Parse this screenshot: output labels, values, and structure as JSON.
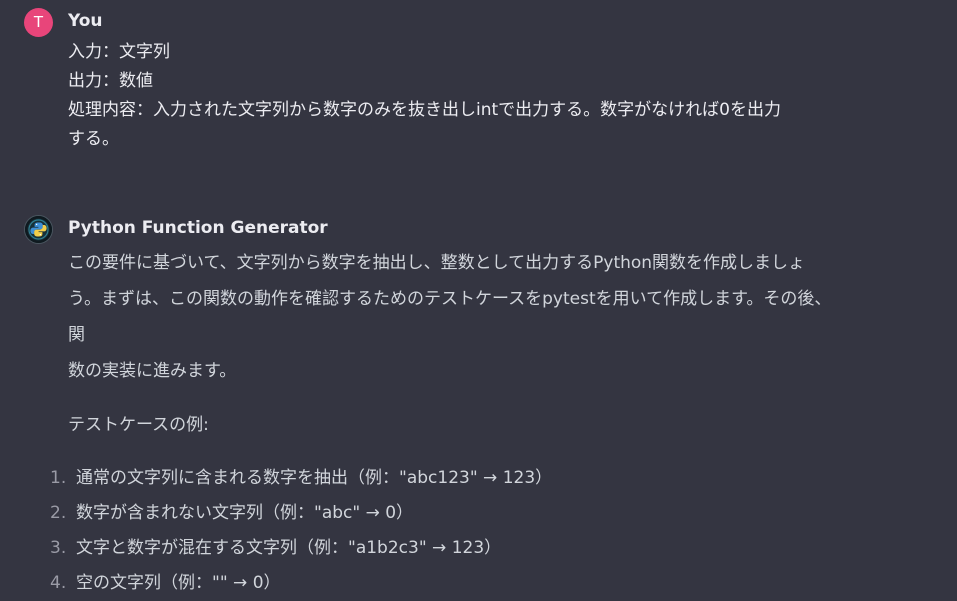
{
  "colors": {
    "background": "#343541",
    "text": "#ececf1",
    "user_avatar": "#e8457a"
  },
  "user_message": {
    "avatar_letter": "T",
    "author": "You",
    "lines": [
      "入力：文字列",
      "出力：数値",
      "処理内容：入力された文字列から数字のみを抜き出しintで出力する。数字がなければ0を出力",
      "する。"
    ]
  },
  "assistant_message": {
    "avatar_icon": "python-icon",
    "author": "Python Function Generator",
    "intro_lines": [
      "この要件に基づいて、文字列から数字を抽出し、整数として出力するPython関数を作成しましょ",
      "う。まずは、この関数の動作を確認するためのテストケースをpytestを用いて作成します。その後、関",
      "数の実装に進みます。"
    ],
    "test_heading": "テストケースの例:",
    "test_cases": [
      {
        "number": "1.",
        "text": "通常の文字列に含まれる数字を抽出（例：\"abc123\" → 123）"
      },
      {
        "number": "2.",
        "text": "数字が含まれない文字列（例：\"abc\" → 0）"
      },
      {
        "number": "3.",
        "text": "文字と数字が混在する文字列（例：\"a1b2c3\" → 123）"
      },
      {
        "number": "4.",
        "text": "空の文字列（例：\"\" → 0）"
      }
    ]
  }
}
